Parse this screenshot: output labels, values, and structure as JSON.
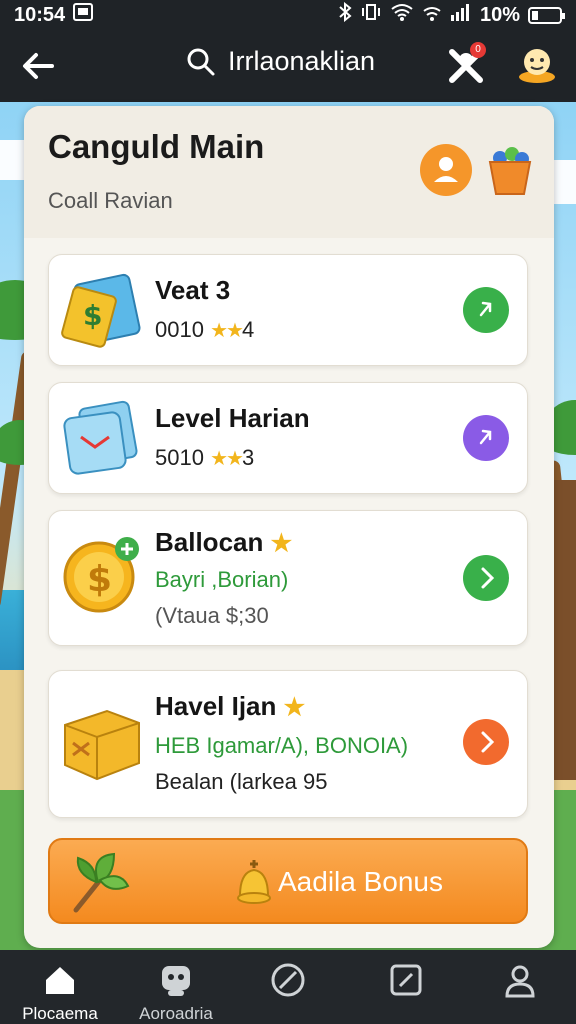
{
  "status_bar": {
    "time": "10:54",
    "battery": "10%"
  },
  "app_bar": {
    "search_text": "Irrlaonaklian",
    "notification_count": "0"
  },
  "panel": {
    "title": "Canguld Main",
    "subtitle": "Coall Ravian"
  },
  "cards": [
    {
      "title": "Veat 3",
      "line1": "0010",
      "stars": "★★",
      "line1_suffix": "4",
      "button_color": "#39b04a"
    },
    {
      "title": "Level Harian",
      "line1": "5010",
      "stars": "★★",
      "line1_suffix": "3",
      "button_color": "#8a5be6"
    },
    {
      "title": "Ballocan",
      "title_star": "★",
      "line1": "Bayri ,Borian)",
      "line2": "(Vtaua $;30",
      "button_color": "#39b04a"
    },
    {
      "title": "Havel Ijan",
      "title_star": "★",
      "line1": "HEB Igamar/A), BONOIA)",
      "line2": "Bealan (larkea 95",
      "button_color": "#f26a2e"
    }
  ],
  "bonus_button": {
    "label": "Aadila Bonus"
  },
  "bottom_nav": [
    {
      "label": "Plocaema",
      "icon": "home-icon",
      "active": true
    },
    {
      "label": "Aoroadria",
      "icon": "game-icon"
    },
    {
      "label": "",
      "icon": "compass-icon"
    },
    {
      "label": "",
      "icon": "edit-icon"
    },
    {
      "label": "",
      "icon": "profile-icon"
    }
  ],
  "colors": {
    "accent": "#f48a1f",
    "bar": "#1f2327",
    "green": "#39b04a",
    "purple": "#8a5be6",
    "orange": "#f26a2e"
  }
}
